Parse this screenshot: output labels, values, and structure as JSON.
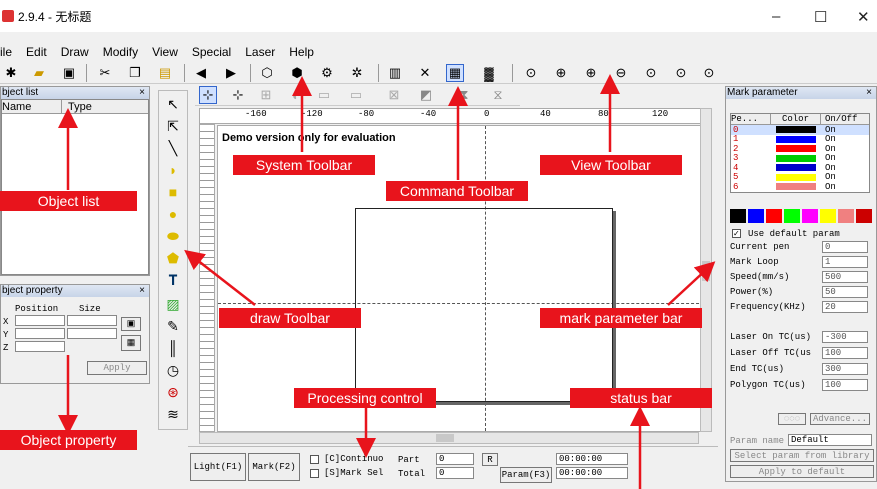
{
  "window": {
    "title": "2.9.4 - 无标题",
    "minimize": "–",
    "maximize": "☐",
    "close": "✕"
  },
  "menu": [
    "ile",
    "Edit",
    "Draw",
    "Modify",
    "View",
    "Special",
    "Laser",
    "Help"
  ],
  "object_list": {
    "title": "bject list",
    "close": "×",
    "col_name": "Name",
    "col_type": "Type"
  },
  "object_property": {
    "title": "bject property",
    "close": "×",
    "col_position": "Position",
    "col_size": "Size",
    "rows": [
      "X",
      "Y",
      "Z"
    ],
    "apply": "Apply"
  },
  "canvas": {
    "watermark": "Demo version only for evaluation",
    "ruler_labels": [
      "-160",
      "-120",
      "-80",
      "-40",
      "0",
      "40",
      "80",
      "120"
    ]
  },
  "mark_parameter": {
    "title": "Mark parameter",
    "close": "×",
    "headers": [
      "Pe...",
      "Color",
      "On/Off"
    ],
    "pens": [
      {
        "id": "0",
        "color": "#000000",
        "state": "On"
      },
      {
        "id": "1",
        "color": "#0000ff",
        "state": "On"
      },
      {
        "id": "2",
        "color": "#ff0000",
        "state": "On"
      },
      {
        "id": "3",
        "color": "#00cc00",
        "state": "On"
      },
      {
        "id": "4",
        "color": "#0000cc",
        "state": "On"
      },
      {
        "id": "5",
        "color": "#ffff00",
        "state": "On"
      },
      {
        "id": "6",
        "color": "#f08080",
        "state": "On"
      }
    ],
    "palette": [
      "#000000",
      "#0000ff",
      "#ff0000",
      "#00ff00",
      "#ff00ff",
      "#ffff00",
      "#f08080",
      "#cc0000"
    ],
    "use_default": "Use default param",
    "params": [
      {
        "label": "Current pen",
        "value": "0"
      },
      {
        "label": "Mark Loop",
        "value": "1"
      },
      {
        "label": "Speed(mm/s)",
        "value": "500"
      },
      {
        "label": "Power(%)",
        "value": "50"
      },
      {
        "label": "Frequency(KHz)",
        "value": "20"
      },
      {
        "label": "Laser On TC(us)",
        "value": "-300"
      },
      {
        "label": "Laser Off TC(us",
        "value": "100"
      },
      {
        "label": "End TC(us)",
        "value": "300"
      },
      {
        "label": "Polygon TC(us)",
        "value": "100"
      }
    ],
    "advance": "Advance...",
    "param_name_label": "Param name",
    "param_name_value": "Default",
    "select_from_library": "Select param from library",
    "apply_default": "Apply to default"
  },
  "processing": {
    "light": "Light(F1)",
    "mark": "Mark(F2)",
    "continuous": "[C]Continuo",
    "mark_sel": "[S]Mark Sel",
    "part_label": "Part",
    "part_value": "0",
    "total_label": "Total",
    "total_value": "0",
    "r_button": "R",
    "param_button": "Param(F3)",
    "time1": "00:00:00",
    "time2": "00:00:00"
  },
  "callouts": {
    "system_toolbar": "System Toolbar",
    "command_toolbar": "Command Toolbar",
    "view_toolbar": "View Toolbar",
    "object_list": "Object list",
    "draw_toolbar": "draw Toolbar",
    "mark_parameter_bar": "mark parameter bar",
    "processing_control": "Processing control",
    "status_bar": "status bar",
    "object_property": "Object property"
  },
  "accent": "#e8141c"
}
